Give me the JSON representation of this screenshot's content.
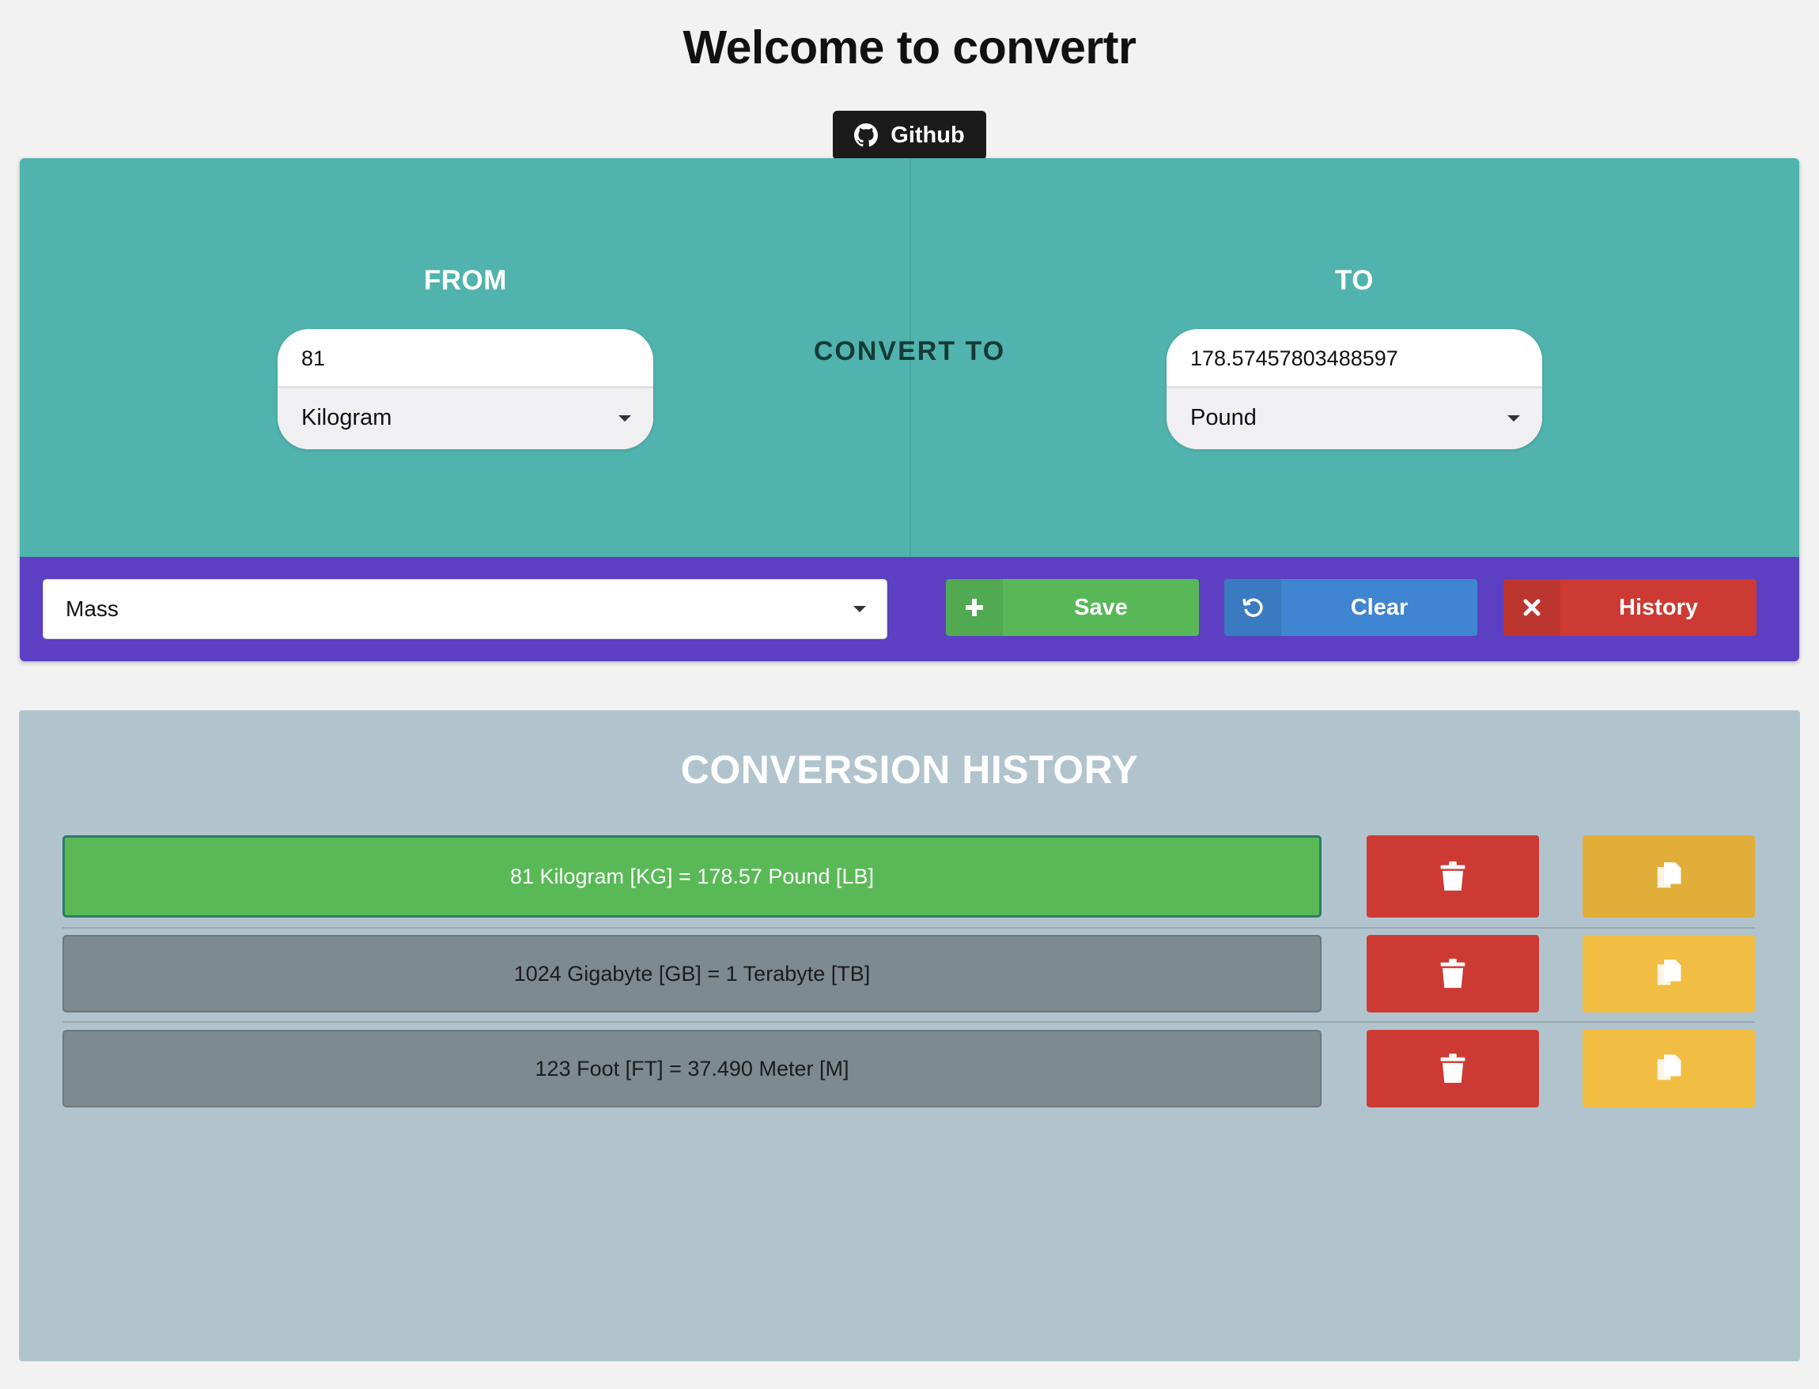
{
  "header": {
    "title": "Welcome to convertr",
    "github_label": "Github"
  },
  "converter": {
    "from_label": "FROM",
    "to_label": "TO",
    "convert_to_label": "CONVERT TO",
    "from_value": "81",
    "from_unit": "Kilogram",
    "to_value": "178.57457803488597",
    "to_unit": "Pound"
  },
  "actions": {
    "category": "Mass",
    "save_label": "Save",
    "clear_label": "Clear",
    "history_label": "History",
    "save_icon": "plus-icon",
    "clear_icon": "undo-icon",
    "history_icon": "times-icon"
  },
  "history": {
    "title": "CONVERSION HISTORY",
    "entries": [
      {
        "text": "81 Kilogram [KG] = 178.57 Pound [LB]",
        "active": true
      },
      {
        "text": "1024 Gigabyte [GB] = 1 Terabyte [TB]",
        "active": false
      },
      {
        "text": "123 Foot [FT] = 37.490 Meter [M]",
        "active": false
      }
    ],
    "delete_icon": "trash-icon",
    "copy_icon": "copy-icon"
  },
  "colors": {
    "converter_bg": "#50b3ad",
    "action_bar_bg": "#5c3fc2",
    "save": "#58b858",
    "clear": "#3f85d1",
    "history": "#cc3a33",
    "copy": "#f1bd42",
    "history_panel_bg": "#b1c4ce",
    "active_entry": "#59b956",
    "inactive_entry": "#7d8a90"
  }
}
